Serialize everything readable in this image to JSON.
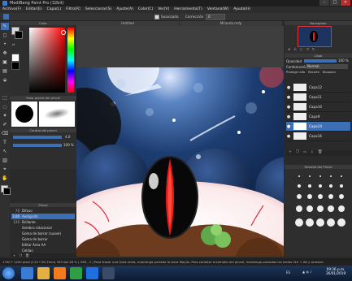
{
  "window": {
    "title": "MediBang Paint Pro (32bit)"
  },
  "menu": [
    "Archivo(F)",
    "Editar(E)",
    "Capa(L)",
    "Filtro(R)",
    "Seleccionar(S)",
    "Ajuste(A)",
    "Color(C)",
    "Ver(V)",
    "Herramienta(T)",
    "Ventana(W)",
    "Ayuda(H)"
  ],
  "toolbar": {
    "antialias_label": "Suavizado",
    "correction_label": "Corrección",
    "correction_value": "0"
  },
  "tabs": [
    "Untitled",
    "Miranda.mdp"
  ],
  "color_panel": {
    "title": "Color",
    "fg": "#d8d8d8",
    "bg": "#000000"
  },
  "brush_preview": {
    "title": "Vista previa del pincel"
  },
  "brush_control": {
    "title": "Control del pincel",
    "size_value": "4.0",
    "opacity_value": "100 %"
  },
  "brush_list": {
    "title": "Pincel",
    "items": [
      {
        "size": "70",
        "name": "Difuso"
      },
      {
        "size": "3.00",
        "name": "Aerógrafo",
        "selected": true
      },
      {
        "size": "120",
        "name": "Brillante"
      },
      {
        "size": "",
        "name": "Sembra rotacional"
      },
      {
        "size": "",
        "name": "Goma de borrar (suave)"
      },
      {
        "size": "",
        "name": "Goma de borrar"
      },
      {
        "size": "",
        "name": "Editar Área AA"
      },
      {
        "size": "",
        "name": "Celdas"
      }
    ]
  },
  "navigator": {
    "title": "Navegador"
  },
  "layers": {
    "title": "Capa",
    "opacity_label": "Opacidad",
    "opacity_value": "100 %",
    "blend_label": "Combinación",
    "blend_value": "Normal",
    "protect_label": "Proteger alfa",
    "clip_label": "Recorte",
    "lock_label": "Bloquear",
    "rows": [
      {
        "name": "Capa12"
      },
      {
        "name": "Capa11"
      },
      {
        "name": "Capa10"
      },
      {
        "name": "Capa9"
      },
      {
        "name": "Capa14",
        "selected": true
      },
      {
        "name": "Capa16"
      }
    ]
  },
  "brush_size": {
    "title": "Tamaño del Pincel"
  },
  "status": {
    "text": "1700 * 1400 pixel   (114 * 90.7mm)   250 dpi   28 %   ( 296, -1 )   Para trazar una línea recta, mantenga pulsada la tecla Mayús. Para cambiar el tamaño del pincel, mantenga pulsadas las teclas Ctrl + Alt y arrastre."
  },
  "taskbar": {
    "language": "ES",
    "time": "09:26 p.m.",
    "date": "26/01/2019"
  }
}
